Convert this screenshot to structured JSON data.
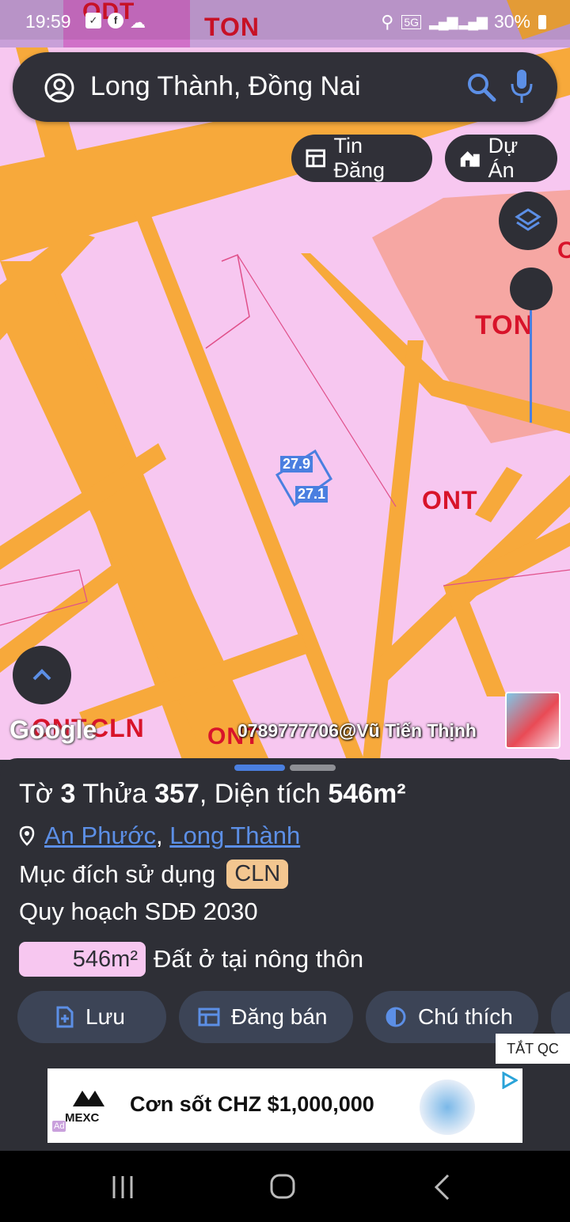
{
  "status_bar": {
    "time": "19:59",
    "network": "5G",
    "battery": "30%"
  },
  "search": {
    "query": "Long Thành, Đồng Nai"
  },
  "chips": {
    "listing": "Tin Đăng",
    "project": "Dự Án"
  },
  "map": {
    "labels": {
      "odt": "ODT",
      "ton_top": "TON",
      "ton_right": "TON",
      "ont_center": "ONT",
      "ont_bottom_left": "ONT",
      "cln_bottom": "CLN",
      "ont_bottom_mid": "ONT",
      "o_right": "O"
    },
    "edge_top": "27.9",
    "edge_bottom": "27.1",
    "google": "Google",
    "watermark": "0789777706@Vũ Tiến Thịnh",
    "zoom_level": 0.09
  },
  "panel": {
    "title_to": "Tờ ",
    "title_to_num": "3",
    "title_thua": " Thửa ",
    "title_thua_num": "357",
    "title_area": ", Diện tích ",
    "title_area_val": "546m²",
    "ward": "An Phước",
    "comma": ",",
    "district": "Long Thành",
    "purpose_label": "Mục đích sử dụng",
    "purpose_badge": "CLN",
    "plan_label": "Quy hoạch SDĐ 2030",
    "plan_area": "546m²",
    "plan_type": "Đất ở tại nông thôn",
    "buttons": {
      "save": "Lưu",
      "sell": "Đăng bán",
      "legend": "Chú thích"
    }
  },
  "ad": {
    "close_label": "TẮT QC",
    "brand": "MEXC",
    "text": "Cơn sốt CHZ $1,000,000",
    "tag": "Ad"
  },
  "colors": {
    "land_pink": "#f7c7f0",
    "road_orange": "#f7a93b",
    "ton_salmon": "#f6a7a3",
    "panel_bg": "#2e2f36",
    "link_blue": "#5c8fe6",
    "cln_badge": "#f3c690"
  }
}
